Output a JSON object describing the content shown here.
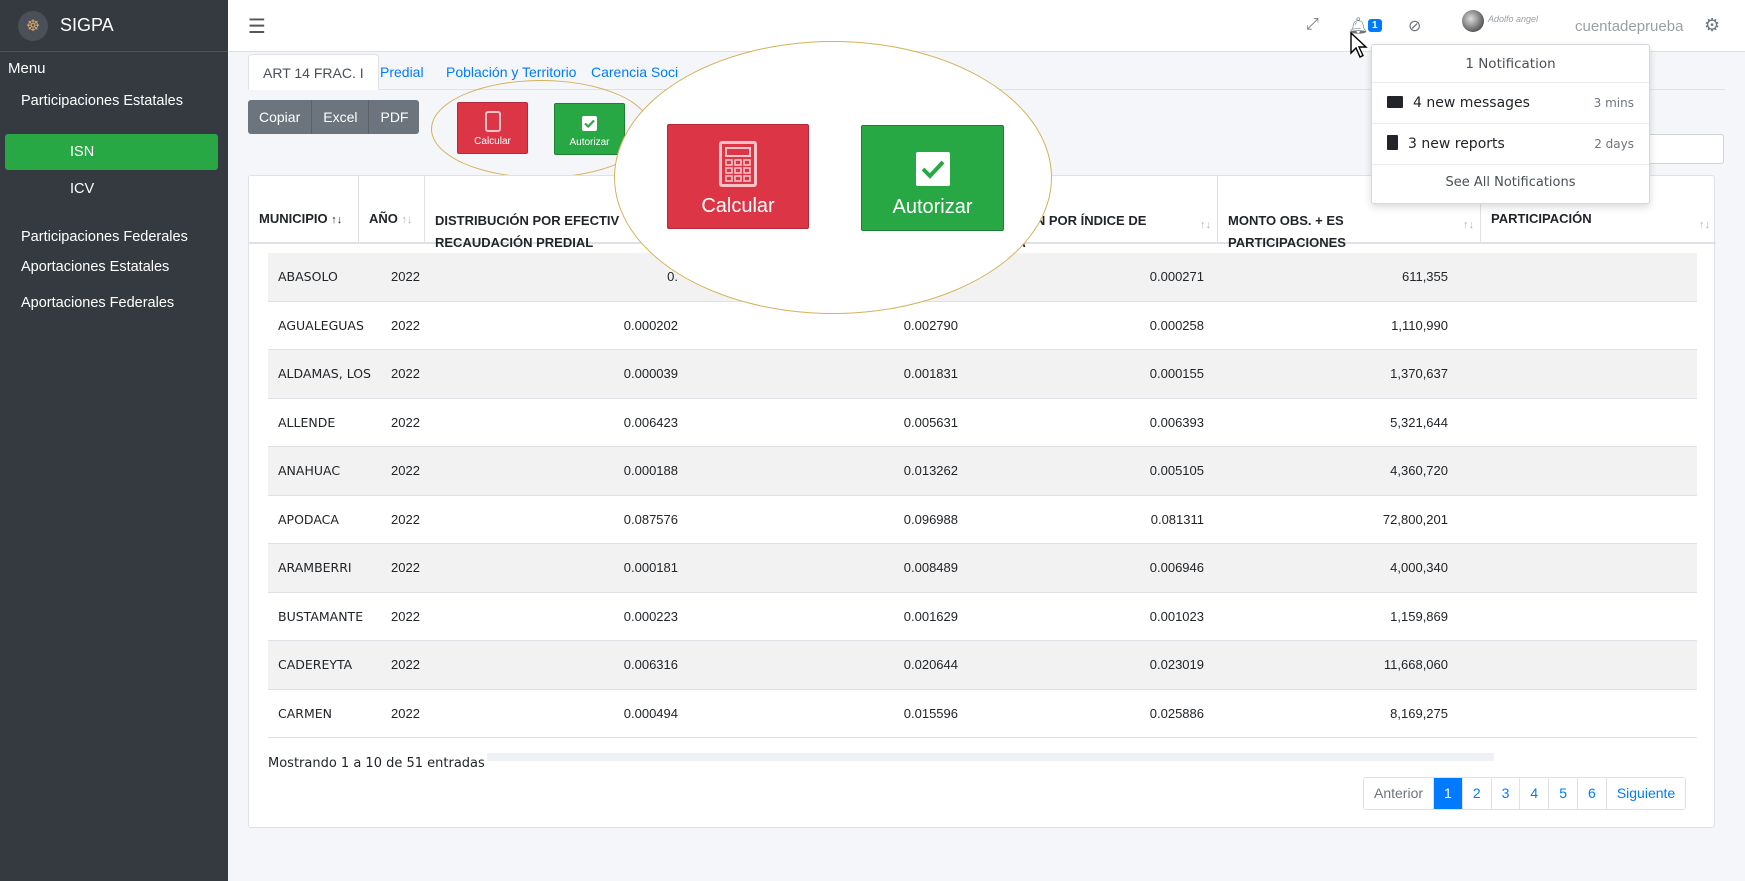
{
  "app": {
    "brand": "SIGPA",
    "account": "cuentadeprueba",
    "user_signature": "Adolfo angel",
    "notification_count": "1"
  },
  "sidebar": {
    "menu_label": "Menu",
    "items": [
      {
        "label": "Participaciones Estatales"
      },
      {
        "label": "ISN"
      },
      {
        "label": "ICV"
      },
      {
        "label": "Participaciones Federales"
      },
      {
        "label": "Aportaciones Estatales"
      },
      {
        "label": "Aportaciones Federales"
      }
    ]
  },
  "tabs": [
    {
      "label": "ART 14 FRAC. I"
    },
    {
      "label": "Predial"
    },
    {
      "label": "Población y Territorio"
    },
    {
      "label": "Carencia Soci"
    }
  ],
  "toolbar": {
    "copy": "Copiar",
    "excel": "Excel",
    "pdf": "PDF",
    "calculate": "Calcular",
    "authorize": "Autorizar"
  },
  "table": {
    "headers": [
      "MUNICIPIO",
      "AÑO",
      "DISTRIBUCIÓN POR EFECTIV\nRECAUDACIÓN PREDIAL",
      "",
      "RIBUCIÓN POR ÍNDICE DE\nBREZA",
      "MONTO OBS. + ES\nPARTICIPACIONES",
      "PARTICIPACIÓN"
    ],
    "rows": [
      {
        "municipio": "ABASOLO",
        "anio": "2022",
        "v1": "0.",
        "v2": "",
        "v3": "0.000271",
        "v4": "611,355"
      },
      {
        "municipio": "AGUALEGUAS",
        "anio": "2022",
        "v1": "0.000202",
        "v2": "0.002790",
        "v3": "0.000258",
        "v4": "1,110,990"
      },
      {
        "municipio": "ALDAMAS, LOS",
        "anio": "2022",
        "v1": "0.000039",
        "v2": "0.001831",
        "v3": "0.000155",
        "v4": "1,370,637"
      },
      {
        "municipio": "ALLENDE",
        "anio": "2022",
        "v1": "0.006423",
        "v2": "0.005631",
        "v3": "0.006393",
        "v4": "5,321,644"
      },
      {
        "municipio": "ANAHUAC",
        "anio": "2022",
        "v1": "0.000188",
        "v2": "0.013262",
        "v3": "0.005105",
        "v4": "4,360,720"
      },
      {
        "municipio": "APODACA",
        "anio": "2022",
        "v1": "0.087576",
        "v2": "0.096988",
        "v3": "0.081311",
        "v4": "72,800,201"
      },
      {
        "municipio": "ARAMBERRI",
        "anio": "2022",
        "v1": "0.000181",
        "v2": "0.008489",
        "v3": "0.006946",
        "v4": "4,000,340"
      },
      {
        "municipio": "BUSTAMANTE",
        "anio": "2022",
        "v1": "0.000223",
        "v2": "0.001629",
        "v3": "0.001023",
        "v4": "1,159,869"
      },
      {
        "municipio": "CADEREYTA",
        "anio": "2022",
        "v1": "0.006316",
        "v2": "0.020644",
        "v3": "0.023019",
        "v4": "11,668,060"
      },
      {
        "municipio": "CARMEN",
        "anio": "2022",
        "v1": "0.000494",
        "v2": "0.015596",
        "v3": "0.025886",
        "v4": "8,169,275"
      }
    ],
    "info": "Mostrando 1 a 10 de 51 entradas"
  },
  "pagination": {
    "prev": "Anterior",
    "pages": [
      "1",
      "2",
      "3",
      "4",
      "5",
      "6"
    ],
    "next": "Siguiente"
  },
  "notifications": {
    "header": "1  Notification",
    "items": [
      {
        "label": "4 new messages",
        "ago": "3 mins",
        "icon": "envelope-icon"
      },
      {
        "label": "3 new reports",
        "ago": "2 days",
        "icon": "file-icon"
      }
    ],
    "footer": "See All Notifications"
  },
  "colors": {
    "sidebar": "#343a40",
    "active": "#28a745",
    "danger": "#dc3545",
    "primary": "#007bff",
    "highlight_ring": "#d4b25a"
  }
}
